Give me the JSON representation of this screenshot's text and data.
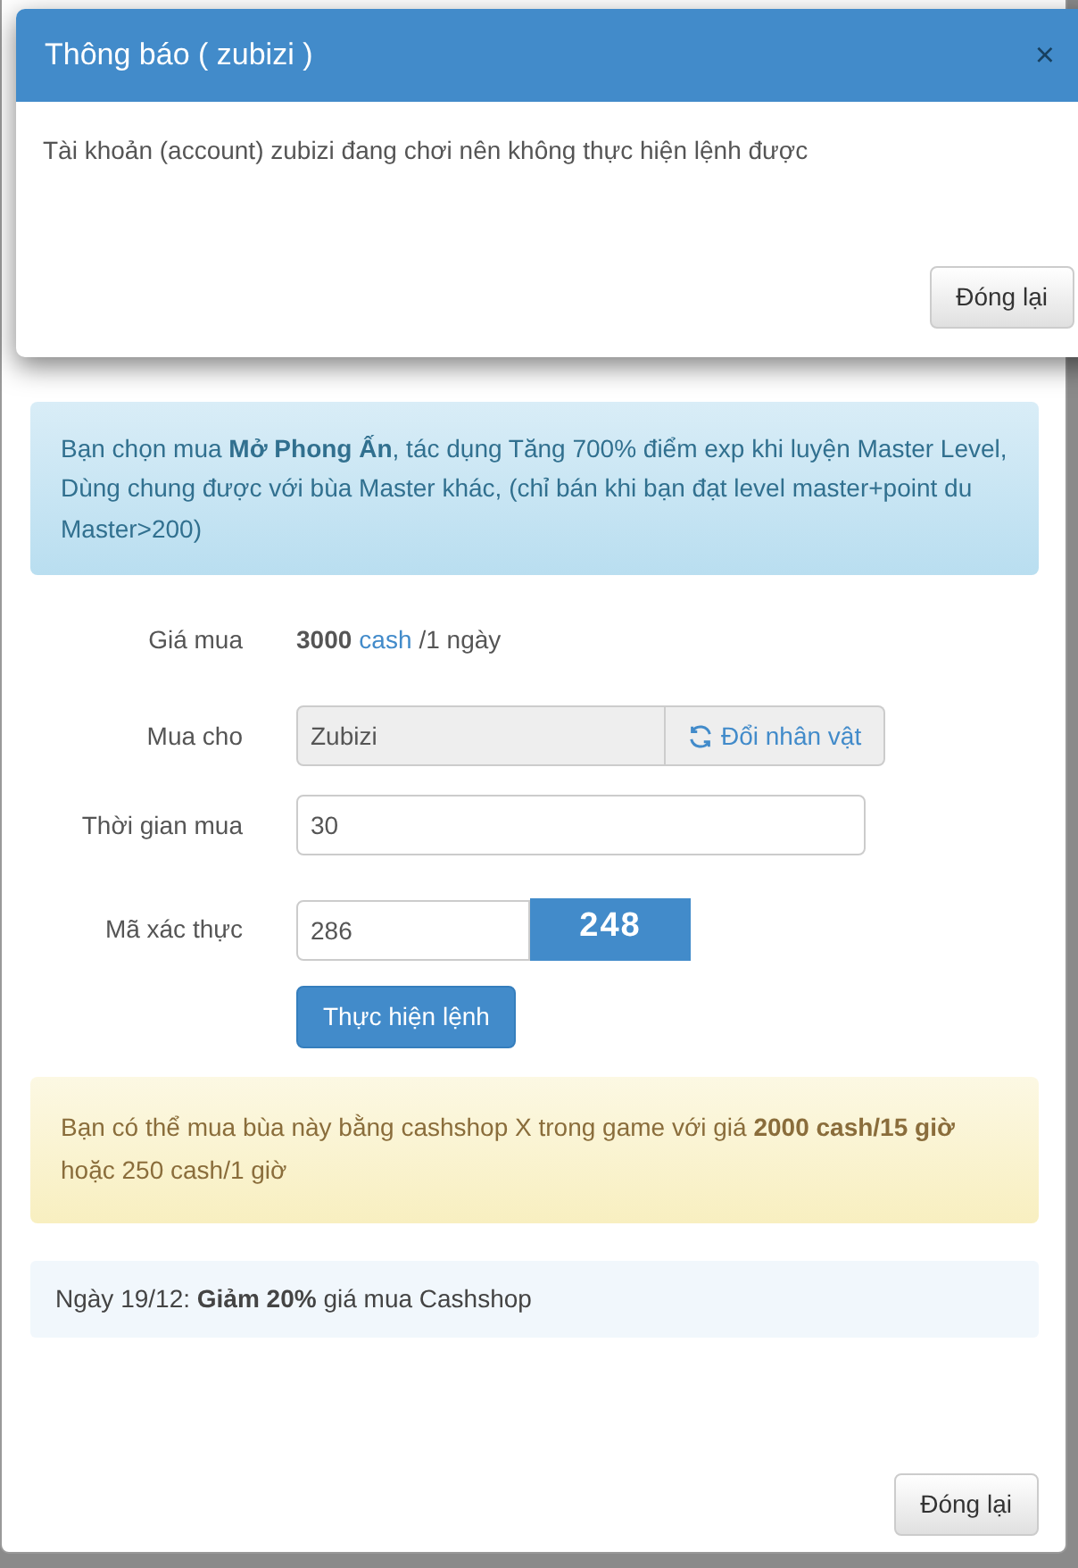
{
  "dialog": {
    "title": "Thông báo ( zubizi )",
    "close_label": "×",
    "message": "Tài khoản (account) zubizi đang chơi nên không thực hiện lệnh được",
    "button": "Đóng lại"
  },
  "purchase": {
    "info": "Bạn chọn mua **Mở Phong Ấn**, tác dụng Tăng 700% điểm exp khi luyện Master Level, Dùng chung được với bùa Master khác, (chỉ bán khi bạn đạt level master+point du Master>200)",
    "fields": [
      {
        "kind": "price",
        "label": "Giá mua",
        "amount": "3000",
        "unit": "cash",
        "period": "/1 ngày"
      },
      {
        "kind": "character",
        "label": "Mua cho",
        "value": "Zubizi",
        "disabled": true,
        "button": "Đổi nhân vật"
      },
      {
        "kind": "input",
        "label": "Thời gian mua",
        "value": "30"
      },
      {
        "kind": "captcha",
        "label": "Mã xác thực",
        "value": "286",
        "code": "248"
      }
    ],
    "submit": "Thực hiện lệnh",
    "warning": "Bạn có thể mua bùa này bằng cashshop X trong game với giá **2000 cash/15 giờ** hoặc 250 cash/1 giờ",
    "notice": "Ngày 19/12: **Giảm 20%** giá mua Cashshop",
    "close_button": "Đóng lại"
  }
}
